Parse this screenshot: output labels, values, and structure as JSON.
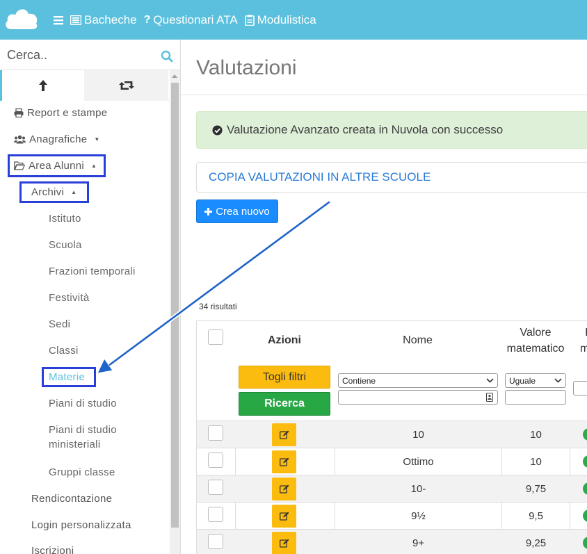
{
  "nav": {
    "items": [
      {
        "label": "Bacheche",
        "icon": "list-icon"
      },
      {
        "label": "Questionari ATA",
        "icon": "question-icon"
      },
      {
        "label": "Modulistica",
        "icon": "clipboard-icon"
      }
    ],
    "logo": "cloud-logo",
    "menu_icon": "hamburger-icon"
  },
  "sidebar": {
    "search_placeholder": "Cerca..",
    "tabs": [
      {
        "icon": "upload-arrow-icon"
      },
      {
        "icon": "retweet-icon"
      }
    ],
    "items": {
      "report": "Report e stampe",
      "anagrafiche": "Anagrafiche",
      "area_alunni": "Area Alunni",
      "archivi": "Archivi",
      "istituto": "Istituto",
      "scuola": "Scuola",
      "frazioni": "Frazioni temporali",
      "festivita": "Festività",
      "sedi": "Sedi",
      "classi": "Classi",
      "materie": "Materie",
      "piani": "Piani di studio",
      "piani_min_1": "Piani di studio",
      "piani_min_2": "ministeriali",
      "gruppi": "Gruppi classe",
      "rendicontazione": "Rendicontazione",
      "login": "Login personalizzata",
      "iscrizioni": "Iscrizioni"
    },
    "caret": "▲",
    "caret_down": "▼"
  },
  "main": {
    "title": "Valutazioni",
    "alert": "Valutazione Avanzato creata in Nuvola con successo",
    "copy_panel": "COPIA VALUTAZIONI IN ALTRE SCUOLE",
    "new_button": "Crea nuovo",
    "results": "34 risultati"
  },
  "table": {
    "headers": {
      "azioni": "Azioni",
      "nome": "Nome",
      "valore_1": "Valore",
      "valore_2": "matematico",
      "cut_1": "I",
      "cut_2": "me"
    },
    "filters": {
      "clear": "Togli filtri",
      "search": "Ricerca",
      "nome_op": "Contiene",
      "valore_op": "Uguale"
    },
    "rows": [
      {
        "nome": "10",
        "valore": "10"
      },
      {
        "nome": "Ottimo",
        "valore": "10"
      },
      {
        "nome": "10-",
        "valore": "9,75"
      },
      {
        "nome": "9½",
        "valore": "9,5"
      },
      {
        "nome": "9+",
        "valore": "9,25"
      }
    ]
  },
  "colors": {
    "topbar": "#5bc0de",
    "highlight_box": "#2a3fd6",
    "arrow": "#1e63c9",
    "alert_bg": "#dff0d8",
    "primary_button": "#1a8cff",
    "warning_button": "#fcbb0f",
    "success_button": "#28a745"
  }
}
